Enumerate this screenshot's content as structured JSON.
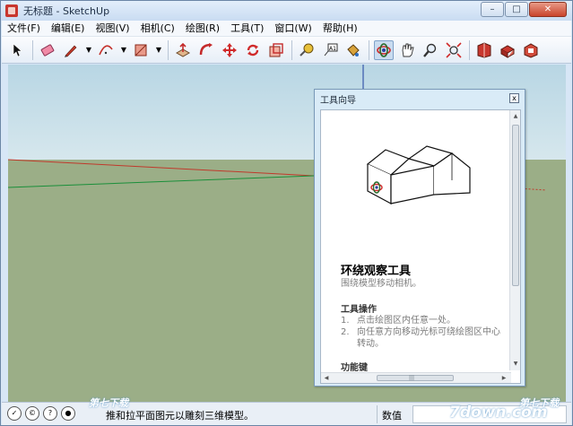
{
  "window": {
    "title": "无标题 - SketchUp"
  },
  "window_buttons": {
    "minimize": "–",
    "maximize": "□",
    "close": "✕"
  },
  "menu": [
    {
      "label": "文件(F)"
    },
    {
      "label": "编辑(E)"
    },
    {
      "label": "视图(V)"
    },
    {
      "label": "相机(C)"
    },
    {
      "label": "绘图(R)"
    },
    {
      "label": "工具(T)"
    },
    {
      "label": "窗口(W)"
    },
    {
      "label": "帮助(H)"
    }
  ],
  "toolbar": [
    {
      "icon": "select-arrow-icon"
    },
    {
      "icon": "eraser-icon"
    },
    {
      "icon": "pencil-line-icon",
      "dropdown": true
    },
    {
      "icon": "arc-icon",
      "dropdown": true
    },
    {
      "icon": "rectangle-icon",
      "dropdown": true
    },
    {
      "icon": "push-pull-icon"
    },
    {
      "icon": "follow-me-icon"
    },
    {
      "icon": "move-icon"
    },
    {
      "icon": "rotate-icon"
    },
    {
      "icon": "scale-icon"
    },
    {
      "icon": "tape-measure-icon"
    },
    {
      "icon": "text-label-icon"
    },
    {
      "icon": "paint-bucket-icon"
    },
    {
      "icon": "orbit-icon",
      "active": true
    },
    {
      "icon": "pan-hand-icon"
    },
    {
      "icon": "zoom-icon"
    },
    {
      "icon": "zoom-extents-icon"
    },
    {
      "icon": "warehouse-icon"
    },
    {
      "icon": "share-model-icon"
    },
    {
      "icon": "extension-icon"
    }
  ],
  "tool_panel": {
    "title": "工具向导",
    "close": "x",
    "tool_name": "环绕观察工具",
    "tool_description": "围绕模型移动相机。",
    "operations_heading": "工具操作",
    "operations": [
      {
        "num": "1.",
        "text": "点击绘图区内任意一处。"
      },
      {
        "num": "2.",
        "text": "向任意方向移动光标可绕绘图区中心转动。"
      }
    ],
    "modifier_heading": "功能键"
  },
  "status": {
    "message": "推和拉平面图元以雕刻三维模型。",
    "value_label": "数值",
    "value": ""
  },
  "watermarks": {
    "left": "第七下载",
    "right": "第七下载",
    "right_domain": "7down.com"
  },
  "colors": {
    "sky_top": "#b8d6e4",
    "ground": "#9bae87",
    "red_axis": "#c0392b",
    "green_axis": "#1a8f3a",
    "blue_axis": "#1c3d9e"
  }
}
